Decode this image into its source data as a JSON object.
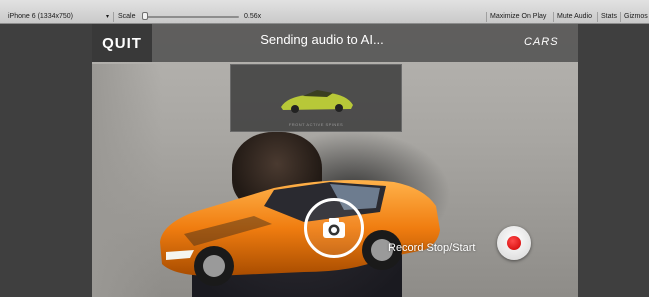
{
  "toolbar": {
    "resolution": "iPhone 6 (1334x750)",
    "scale_label": "Scale",
    "scale_value": "0.56x",
    "scale_fraction": 0.02,
    "maximize_on_play": "Maximize On Play",
    "mute_audio": "Mute Audio",
    "stats": "Stats",
    "gizmos": "Gizmos"
  },
  "hud": {
    "quit_label": "QUIT",
    "status": "Sending audio to AI...",
    "logo": "CARS",
    "catalog_caption": "FRONT ACTIVE SPINES",
    "record_label": "Record Stop/Start"
  },
  "colors": {
    "car_body": "#f07d10",
    "record_dot": "#e01010",
    "mini_car": "#b8c838"
  }
}
